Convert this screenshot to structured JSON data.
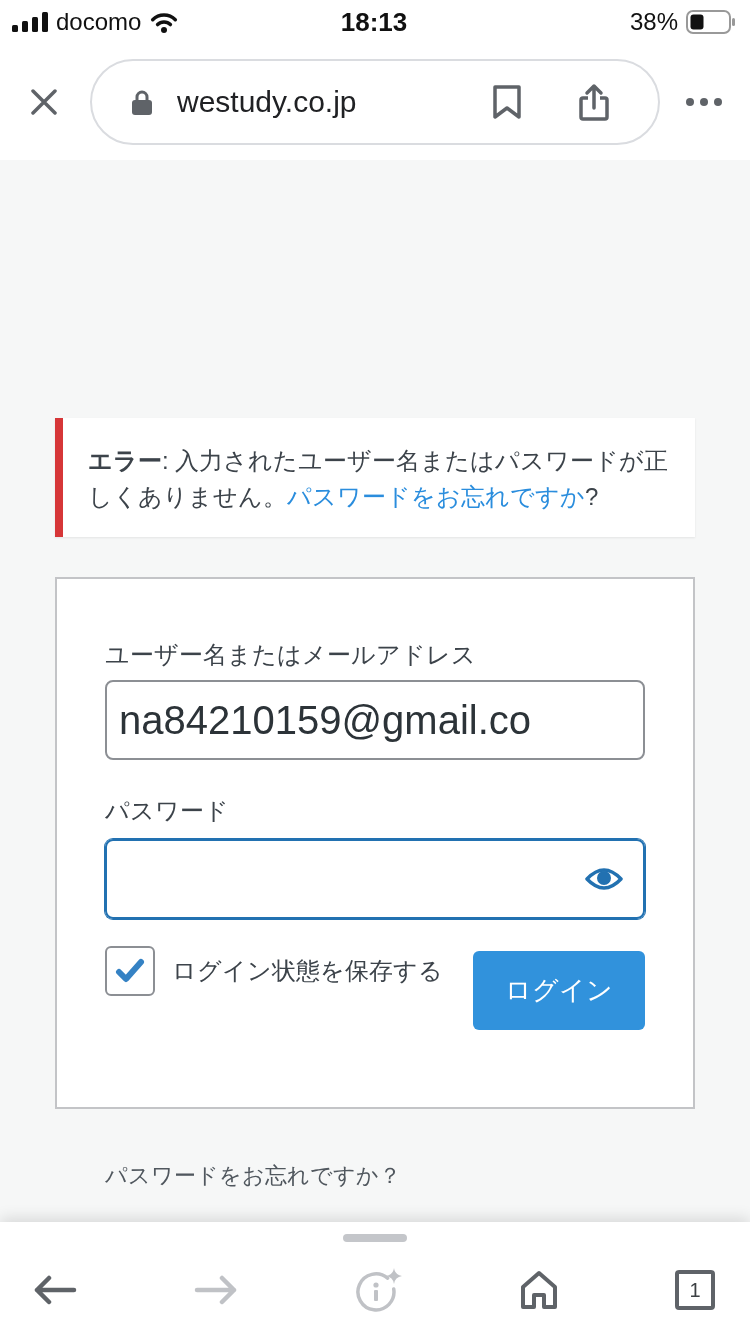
{
  "status_bar": {
    "carrier": "docomo",
    "time": "18:13",
    "battery": "38%"
  },
  "browser_bar": {
    "url": "westudy.co.jp"
  },
  "error_notice": {
    "message": "**エラー**: 入力されたユーザー名またはパスワードが正しくありません。",
    "link": "パスワードをお忘れですか",
    "suffix": "?"
  },
  "login_form": {
    "username": {
      "label": "ユーザー名またはメールアドレス",
      "value": "na84210159@gmail.co",
      "focused": false
    },
    "password": {
      "label": "パスワード",
      "focused": true
    },
    "remember": {
      "label": "ログイン状態を保存する",
      "checked": true
    },
    "submit": "ログイン"
  },
  "lost_password_link": "パスワードをお忘れですか？",
  "bottom_toolbar": [
    {
      "kind": "back",
      "disabled": false
    },
    {
      "kind": "forward",
      "disabled": true
    },
    {
      "kind": "lens",
      "disabled": true
    },
    {
      "kind": "home",
      "disabled": false
    },
    {
      "kind": "tabs",
      "count": "1",
      "disabled": false
    }
  ]
}
